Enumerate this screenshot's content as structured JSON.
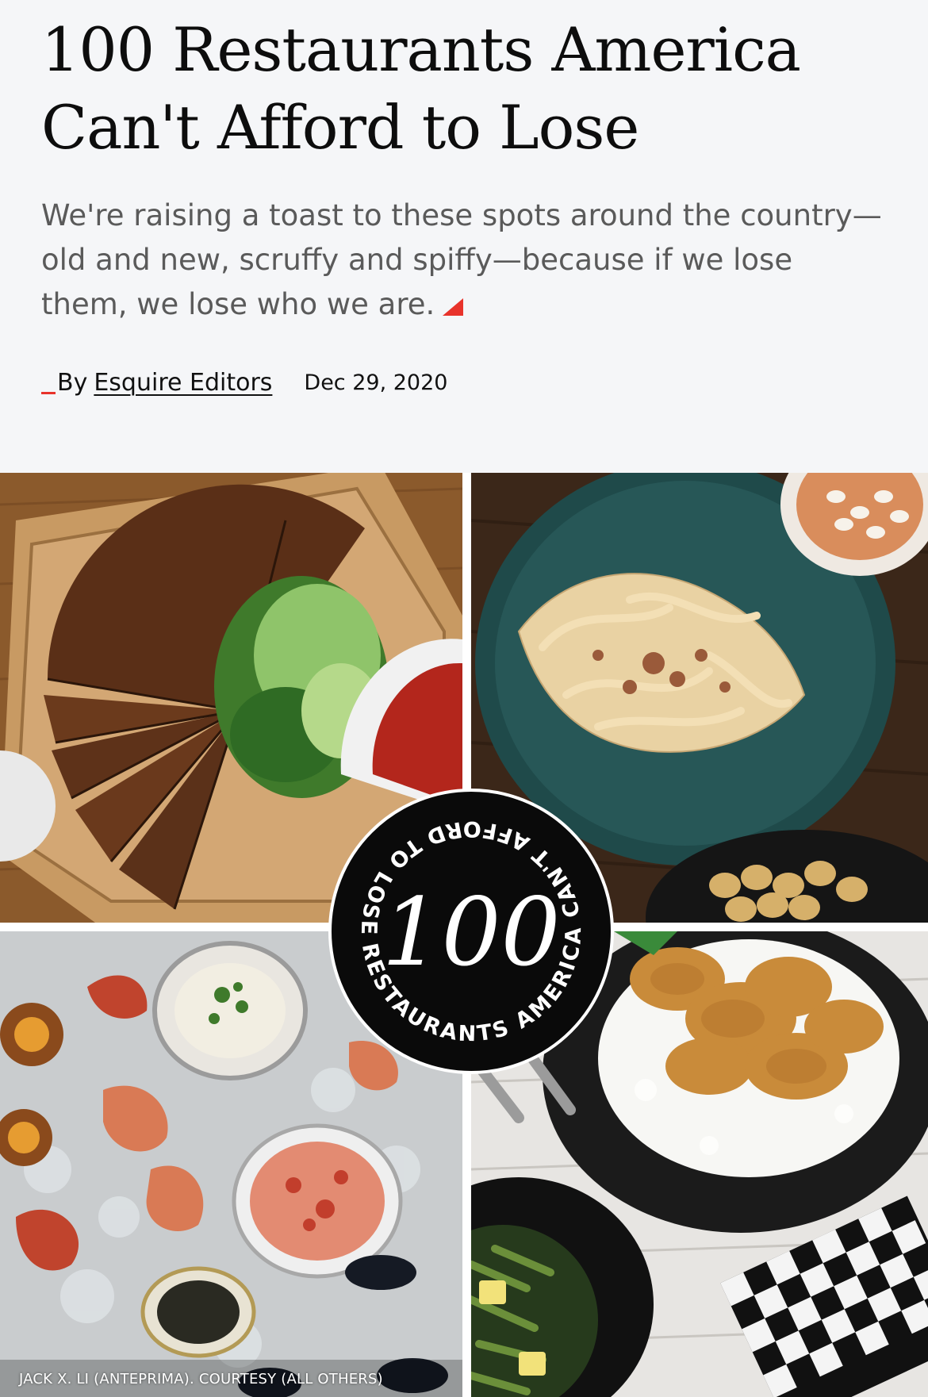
{
  "article": {
    "title": "100 Restaurants America Can't Afford to Lose",
    "dek": "We're raising a toast to these spots around the country—old and new, scruffy and spiffy—because if we lose them, we lose who we are.",
    "by_label": "By",
    "author": "Esquire Editors",
    "date": "Dec 29, 2020"
  },
  "hero": {
    "badge_number": "100",
    "badge_ring_text": "RESTAURANTS AMERICA CAN'T AFFORD TO LOSE • 100",
    "photo_credit": "JACK X. LI (ANTEPRIMA). COURTESY (ALL OTHERS)"
  },
  "colors": {
    "accent": "#e8332b",
    "header_bg": "#f5f6f8",
    "badge_bg": "#0a0a0a"
  },
  "icons": [
    "corner-triangle-icon"
  ]
}
